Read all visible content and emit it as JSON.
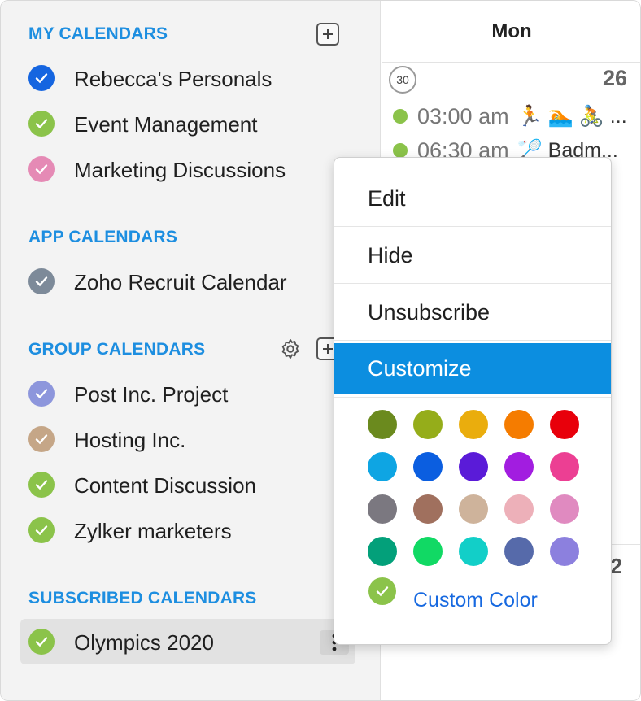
{
  "sidebar": {
    "sections": {
      "my": "MY CALENDARS",
      "app": "APP CALENDARS",
      "group": "GROUP CALENDARS",
      "subscribed": "SUBSCRIBED CALENDARS"
    },
    "my_calendars": [
      {
        "label": "Rebecca's Personals",
        "color": "#1565e0"
      },
      {
        "label": "Event Management",
        "color": "#8bc34a"
      },
      {
        "label": "Marketing Discussions",
        "color": "#e58ab5"
      }
    ],
    "app_calendars": [
      {
        "label": "Zoho Recruit Calendar",
        "color": "#7d8a99"
      }
    ],
    "group_calendars": [
      {
        "label": "Post Inc. Project",
        "color": "#8d96dc"
      },
      {
        "label": "Hosting Inc.",
        "color": "#c5a687"
      },
      {
        "label": "Content Discussion",
        "color": "#8bc34a"
      },
      {
        "label": "Zylker marketers",
        "color": "#8bc34a"
      }
    ],
    "subscribed_calendars": [
      {
        "label": "Olympics 2020",
        "color": "#8bc34a"
      }
    ]
  },
  "grid": {
    "day_header": "Mon",
    "week_number": "30",
    "day_number": "26",
    "day_number_next": "2",
    "events": [
      {
        "time": "03:00 am",
        "title": "🏃 🏊 🚴 ..."
      },
      {
        "time": "06:30 am",
        "title": "🏸 Badm..."
      }
    ]
  },
  "context_menu": {
    "items": [
      "Edit",
      "Hide",
      "Unsubscribe",
      "Customize"
    ],
    "active": "Customize",
    "swatches": [
      "#6b8a1e",
      "#95ad1a",
      "#eaad0d",
      "#f57c00",
      "#e8000b",
      "#0ea5e3",
      "#0b5ee0",
      "#5a1bd8",
      "#a21de0",
      "#ec3f93",
      "#7b7880",
      "#a0705e",
      "#ceb39b",
      "#edb0b9",
      "#e08ac0",
      "#03a07a",
      "#11d964",
      "#12cfc8",
      "#566aaa",
      "#8c80de"
    ],
    "custom_color_label": "Custom Color",
    "custom_color_selected": "#8bc34a"
  }
}
